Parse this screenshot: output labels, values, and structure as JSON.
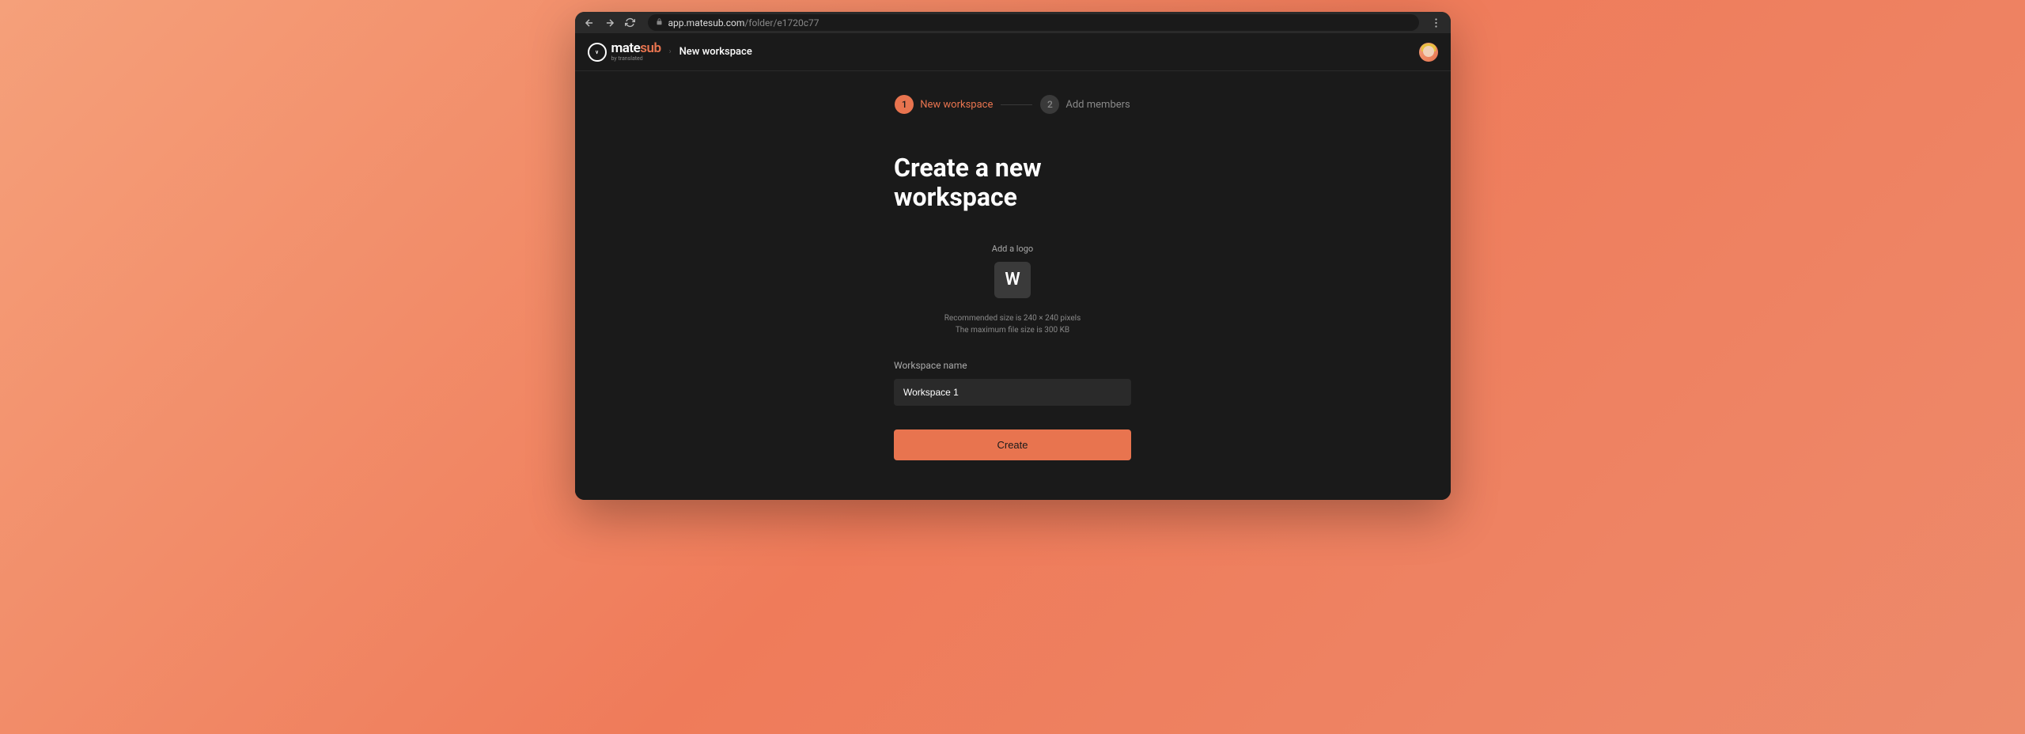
{
  "browser": {
    "url_domain": "app.matesub.com",
    "url_path": "/folder/e1720c77"
  },
  "header": {
    "logo_main": "mate",
    "logo_sub": "sub",
    "logo_byline": "by translated",
    "breadcrumb": "New workspace"
  },
  "stepper": {
    "step1_num": "1",
    "step1_label": "New workspace",
    "step2_num": "2",
    "step2_label": "Add members"
  },
  "page": {
    "heading": "Create a new workspace",
    "upload_label": "Add a logo",
    "logo_letter": "W",
    "hint_line1": "Recommended size is 240 × 240 pixels",
    "hint_line2": "The maximum file size is 300 KB",
    "field_label": "Workspace name",
    "field_value": "Workspace 1",
    "button_label": "Create"
  }
}
